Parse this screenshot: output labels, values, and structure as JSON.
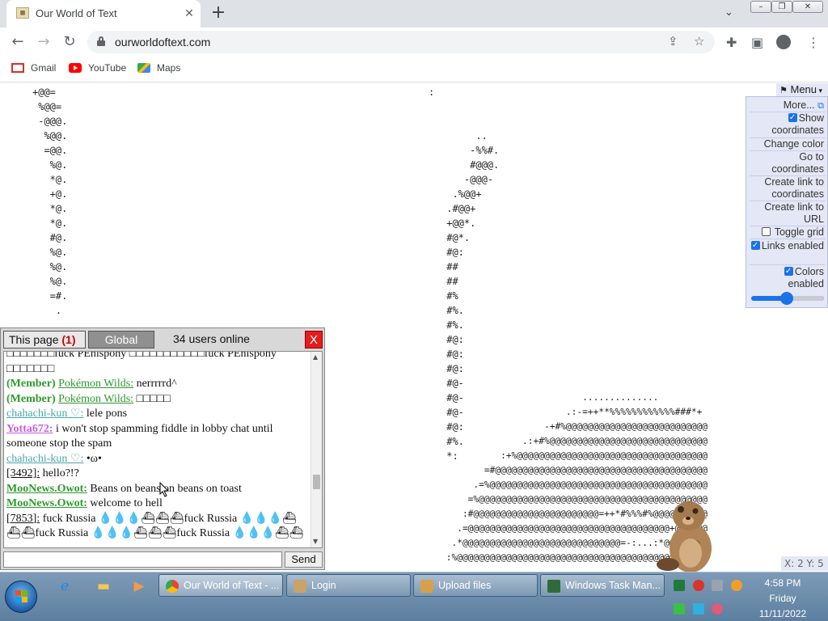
{
  "browser": {
    "tab_title": "Our World of Text",
    "url": "ourworldoftext.com",
    "bookmarks": [
      "Gmail",
      "YouTube",
      "Maps"
    ]
  },
  "world_art": {
    "left_spiral": "+@@=\n %@@=\n -@@@.\n  %@@.\n  =@@.\n   %@.\n   *@.\n   +@.\n   *@.\n   *@.\n   #@.\n   %@.\n   %@.\n   %@.\n   =#.\n    .",
    "colon": ":",
    "middle_curve": "      ..\n     -%%#.\n     #@@@.\n    -@@@-\n  .%@@+\n .#@@+\n +@@*.\n #@*.\n #@:\n ##\n ##\n #%\n #%.\n #%.\n #@:\n #@:\n #@:\n #@-\n #@-\n #@-\n #@:\n #%.\n *:",
    "right_mass": "                          ..............\n                       .:-=++**%%%%%%%%%%%%###*+\n                   -+#%@@@@@@@@@@@@@@@@@@@@@@@@@@\n               .:+#%@@@@@@@@@@@@@@@@@@@@@@@@@@@@@\n           :+%@@@@@@@@@@@@@@@@@@@@@@@@@@@@@@@@@@@\n        =#@@@@@@@@@@@@@@@@@@@@@@@@@@@@@@@@@@@@@@@\n      .=%@@@@@@@@@@@@@@@@@@@@@@@@@@@@@@@@@@@@@@@@\n     =%@@@@@@@@@@@@@@@@@@@@@@@@@@@@@@@@@@@@@@@@@@\n    :#@@@@@@@@@@@@@@@@@@@@@@@=++*#%%%#%@@@@@@@@@@\n   .=@@@@@@@@@@@@@@@@@@@@@@@@@@@@@@@@@@@@@+@@@@@@\n  .*@@@@@@@@@@@@@@@@@@@@@@@@@@@@@=-:...:*@@@@@@@@\n :%@@@@@@@@@@@@@@@@@@@@@@@@@@@@@@@@@@@@@@@@@@@@@@"
  },
  "menu": {
    "title": "Menu",
    "items": {
      "more": "More...",
      "show_coordinates": "Show coordinates",
      "change_color": "Change color",
      "go_to_coordinates": "Go to coordinates",
      "create_link_coords": "Create link to coordinates",
      "create_link_url": "Create link to URL",
      "toggle_grid": "Toggle grid",
      "links_enabled": "Links enabled",
      "colors_enabled": "Colors enabled"
    },
    "checked": {
      "show_coordinates": true,
      "toggle_grid": false,
      "links_enabled": true,
      "colors_enabled": true
    },
    "zoom_fraction": 0.45
  },
  "chat": {
    "tab_page": "This page",
    "tab_page_unread": "(1)",
    "tab_global": "Global",
    "users_online": "34 users online",
    "close": "X",
    "send": "Send",
    "input_value": "",
    "messages": [
      {
        "nick": "",
        "text": "□□□□□□□fuck PEnispony □□□□□□□□□□□fuck PEnispony □□□□□□□"
      },
      {
        "prefix": "(Member)",
        "nick": "Pokémon Wilds:",
        "text": " nerrrrrd^"
      },
      {
        "prefix": "(Member)",
        "nick": "Pokémon Wilds:",
        "text": " □□□□□"
      },
      {
        "nick": "chahachi-kun ♡:",
        "text": " lele pons"
      },
      {
        "nick": "Yotta672:",
        "text": " i won't stop spamming fiddle in lobby chat until someone stop the spam"
      },
      {
        "nick": "chahachi-kun ♡:",
        "text": " •ω•"
      },
      {
        "nick": "[3492]:",
        "text": " hello?!?"
      },
      {
        "nick": "MooNews.Owot:",
        "text": " Beans on beans on beans on toast"
      },
      {
        "nick": "MooNews.Owot:",
        "text": " welcome to hell"
      },
      {
        "nick": "[7853]:",
        "text": " fuck Russia 💧💧💧⛴⛴⛴fuck Russia 💧💧💧⛴⛴⛴fuck Russia 💧💧💧⛴⛴⛴fuck Russia 💧💧💧⛴⛴"
      }
    ]
  },
  "coords_readout": "X: 2 Y: 5",
  "taskbar": {
    "buttons": [
      "Our World of Text - ...",
      "Login",
      "Upload files",
      "Windows Task Man..."
    ],
    "time": "4:58 PM",
    "day": "Friday",
    "date": "11/11/2022"
  },
  "colors": {
    "chat_green": "#2e9a2e",
    "chat_teal": "#4aa6a6",
    "chat_purple": "#c65ee0",
    "close_red": "#e21e1e",
    "menu_bg": "#e4e7f5"
  }
}
